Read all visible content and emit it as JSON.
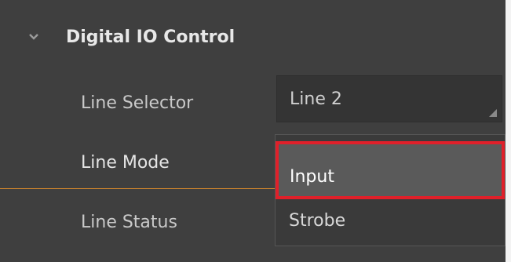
{
  "group": {
    "title": "Digital IO Control",
    "expanded_icon": "chevron-down-icon"
  },
  "rows": {
    "line_selector": {
      "label": "Line Selector",
      "value": "Line 2"
    },
    "line_mode": {
      "label": "Line Mode"
    },
    "line_status": {
      "label": "Line Status"
    }
  },
  "dropdown": {
    "options": [
      "Input",
      "Strobe"
    ],
    "highlighted": "Input"
  },
  "colors": {
    "panel_bg": "#3f3f3f",
    "highlight_border": "#e0202a",
    "separator": "#d98a2b"
  }
}
